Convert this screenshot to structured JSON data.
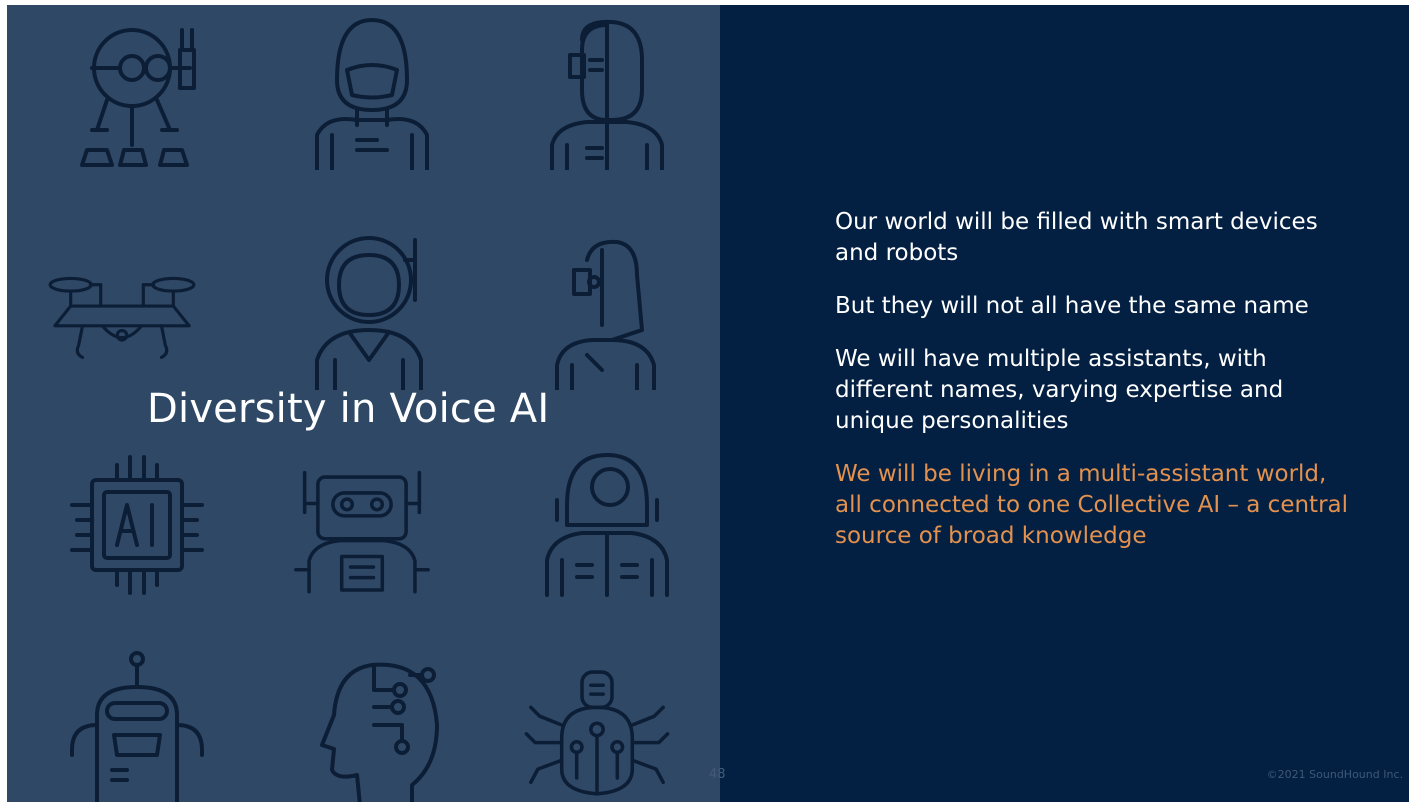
{
  "slide": {
    "title": "Diversity in Voice AI",
    "bullets": [
      "Our world will be filled with smart devices and robots",
      "But they will not all have the same name",
      "We will have multiple assistants, with different names, varying expertise and unique personalities",
      "We will be living in a multi-assistant world, all connected to one Collective AI – a central source of broad knowledge"
    ],
    "page_number": "48",
    "copyright": "©2021 SoundHound Inc."
  },
  "colors": {
    "slide_background": "#032043",
    "left_panel": "#2f4866",
    "icon_stroke": "#0c1e36",
    "text": "#ffffff",
    "highlight": "#e2914e"
  },
  "icons": [
    "one-eyed-robot-icon",
    "helmet-robot-icon",
    "half-cyborg-man-icon",
    "drone-icon",
    "astronaut-robot-icon",
    "female-cyborg-icon",
    "ai-chip-icon",
    "boxy-robot-icon",
    "space-suit-robot-icon",
    "antenna-robot-icon",
    "ai-head-icon",
    "bug-robot-icon"
  ]
}
